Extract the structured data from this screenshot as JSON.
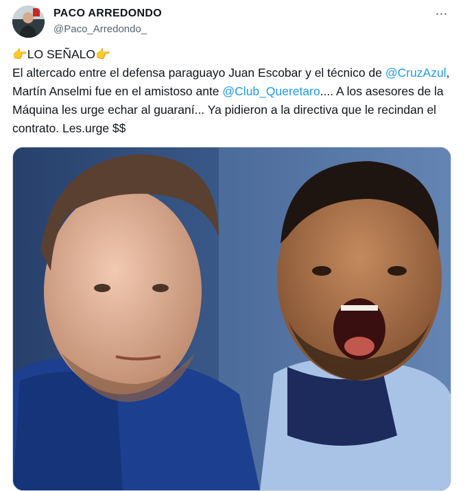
{
  "author": {
    "display_name": "PACO ARREDONDO",
    "handle": "@Paco_Arredondo_"
  },
  "menu": {
    "more_icon": "⋯"
  },
  "tweet": {
    "headline": "👉LO SEÑALO👉",
    "line1": "El altercado entre el defensa paraguayo Juan Escobar y el técnico de",
    "mention_cruzazul": "@CruzAzul",
    "mid_text": ", Martín Anselmi fue en el amistoso ante ",
    "mention_queretaro": "@Club_Queretaro",
    "tail_text": ".... A los asesores de la Máquina les urge echar al guaraní... Ya pidieron a la directiva que le recindan el contrato.  Les.urge $$"
  },
  "media": {
    "kind": "photo",
    "description_icon": "photo-of-two-men"
  },
  "colors": {
    "link": "#1d9bf0",
    "text": "#0f1419",
    "secondary": "#536471",
    "border": "#cfd9de"
  }
}
